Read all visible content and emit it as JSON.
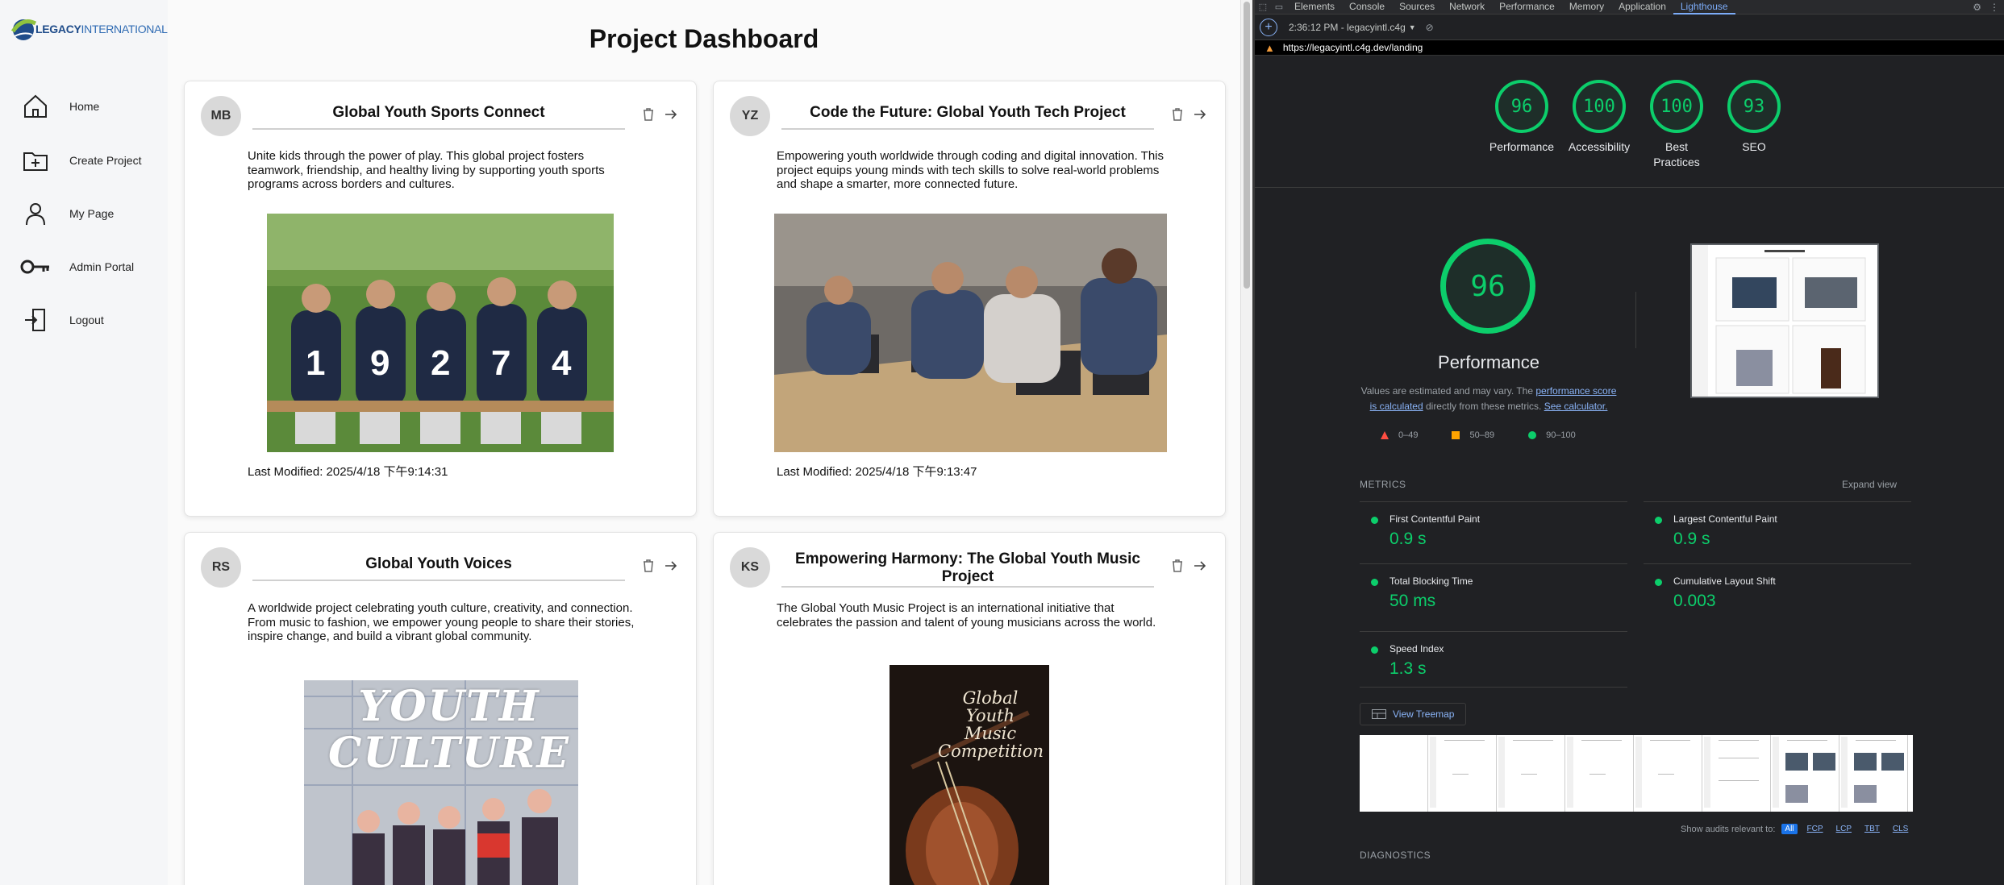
{
  "brand": {
    "logo_text_bold": "LEGACY",
    "logo_text_thin": "INTERNATIONAL"
  },
  "sidebar": {
    "items": [
      {
        "label": "Home",
        "icon": "home-icon"
      },
      {
        "label": "Create Project",
        "icon": "folder-plus-icon"
      },
      {
        "label": "My Page",
        "icon": "user-icon"
      },
      {
        "label": "Admin Portal",
        "icon": "key-icon"
      },
      {
        "label": "Logout",
        "icon": "logout-icon"
      }
    ]
  },
  "main": {
    "title": "Project Dashboard",
    "cards": [
      {
        "initials": "MB",
        "title": "Global Youth Sports Connect",
        "description": "Unite kids through the power of play. This global project fosters teamwork, friendship, and healthy living by supporting youth sports programs across borders and cultures.",
        "last_modified": "Last Modified: 2025/4/18 下午9:14:31"
      },
      {
        "initials": "YZ",
        "title": "Code the Future: Global Youth Tech Project",
        "description": "Empowering youth worldwide through coding and digital innovation. This project equips young minds with tech skills to solve real-world problems and shape a smarter, more connected future.",
        "last_modified": "Last Modified: 2025/4/18 下午9:13:47"
      },
      {
        "initials": "RS",
        "title": "Global Youth Voices",
        "description": "A worldwide project celebrating youth culture, creativity, and connection. From music to fashion, we empower young people to share their stories, inspire change, and build a vibrant global community.",
        "image_text": "YOUTH CULTURE"
      },
      {
        "initials": "KS",
        "title": "Empowering Harmony: The Global Youth Music Project",
        "description": "The Global Youth Music Project is an international initiative that celebrates the passion and talent of young musicians across the world.",
        "image_text": "Global Youth Music Competition"
      }
    ]
  },
  "devtools": {
    "tabs": [
      "Elements",
      "Console",
      "Sources",
      "Network",
      "Performance",
      "Memory",
      "Application",
      "Lighthouse"
    ],
    "active_tab": "Lighthouse",
    "report_select": "2:36:12 PM - legacyintl.c4g",
    "url": "https://legacyintl.c4g.dev/landing",
    "scores": [
      {
        "value": "96",
        "label": "Performance"
      },
      {
        "value": "100",
        "label": "Accessibility"
      },
      {
        "value": "100",
        "label": "Best Practices"
      },
      {
        "value": "93",
        "label": "SEO"
      }
    ],
    "big_score": "96",
    "perf_title": "Performance",
    "note_prefix": "Values are estimated and may vary. The ",
    "note_link1": "performance score is calculated",
    "note_middle": " directly from these metrics. ",
    "note_link2": "See calculator.",
    "legend": [
      {
        "range": "0–49",
        "color": "#ff4e42"
      },
      {
        "range": "50–89",
        "color": "#ffa400"
      },
      {
        "range": "90–100",
        "color": "#0cce6b"
      }
    ],
    "metrics_label": "METRICS",
    "expand_view": "Expand view",
    "metrics": [
      {
        "name": "First Contentful Paint",
        "value": "0.9 s"
      },
      {
        "name": "Largest Contentful Paint",
        "value": "0.9 s"
      },
      {
        "name": "Total Blocking Time",
        "value": "50 ms"
      },
      {
        "name": "Cumulative Layout Shift",
        "value": "0.003"
      },
      {
        "name": "Speed Index",
        "value": "1.3 s"
      }
    ],
    "treemap_label": "View Treemap",
    "audits_label": "Show audits relevant to:",
    "audit_filters": [
      "All",
      "FCP",
      "LCP",
      "TBT",
      "CLS"
    ],
    "diagnostics_label": "DIAGNOSTICS",
    "accent": "#0cce6b",
    "link_color": "#8ab4f8"
  }
}
